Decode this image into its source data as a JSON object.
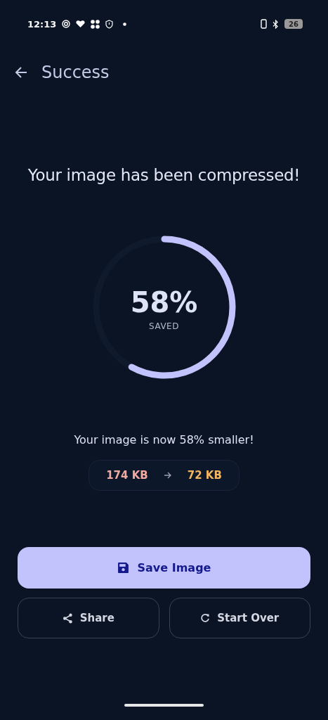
{
  "status_bar": {
    "time": "12:13",
    "battery": "26"
  },
  "app_bar": {
    "title": "Success"
  },
  "heading": "Your image has been compressed!",
  "progress": {
    "value": "58%",
    "label": "SAVED"
  },
  "message": "Your image is now 58% smaller!",
  "sizes": {
    "before": "174 KB",
    "after": "72 KB"
  },
  "buttons": [
    {
      "kind": "primary",
      "label": "Save Image"
    },
    {
      "kind": "outline",
      "label": "Share"
    },
    {
      "kind": "outline",
      "label": "Start Over"
    }
  ]
}
